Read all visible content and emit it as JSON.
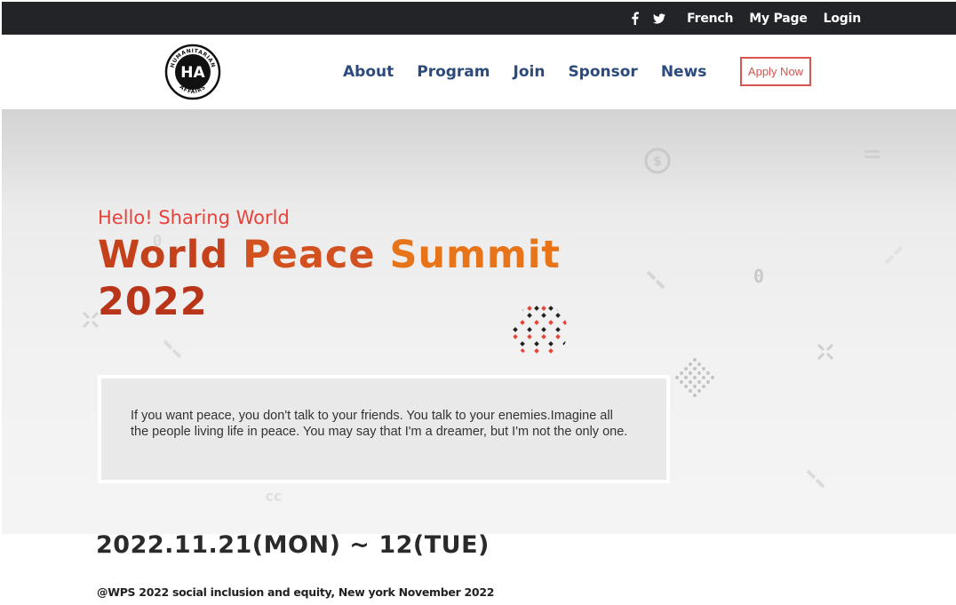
{
  "topbar": {
    "social": [
      {
        "icon": "facebook-icon",
        "glyph": "f"
      },
      {
        "icon": "twitter-icon",
        "glyph": "t"
      }
    ],
    "links": [
      "French",
      "My Page",
      "Login"
    ]
  },
  "header": {
    "logo_text_top": "HUMANITARIAN",
    "logo_text_bottom": "AFFAIRS",
    "logo_monogram": "HA",
    "nav": [
      "About",
      "Program",
      "Join",
      "Sponsor",
      "News"
    ],
    "apply_label": "Apply Now"
  },
  "hero": {
    "greeting": "Hello! Sharing World",
    "title_words": [
      "World",
      "Peace",
      "Summit",
      "2022"
    ],
    "quote": "If you want peace, you don't talk to your friends. You talk to your enemies.Imagine all the people living life in peace. You may say that I'm a dreamer, but I'm not the only one."
  },
  "event": {
    "date": "2022.11.21(MON) ~ 12(TUE)",
    "subtitle": "@WPS 2022 social inclusion and equity, New york November 2022"
  },
  "colors": {
    "topbar_bg": "#222428",
    "nav_text": "#2b4a7e",
    "accent_red": "#e8433a",
    "title_orange": "#e8741a"
  }
}
